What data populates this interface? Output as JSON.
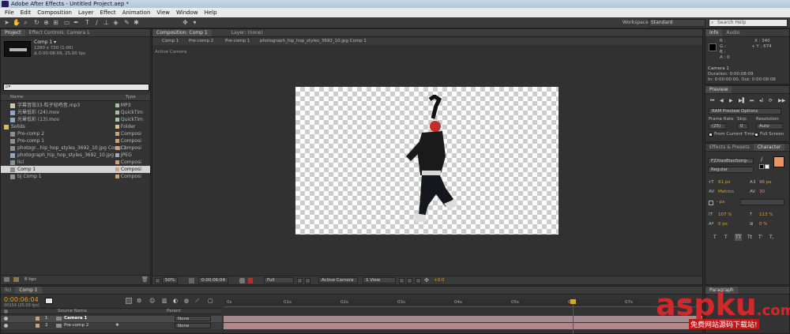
{
  "title": "Adobe After Effects - Untitled Project.aep *",
  "menu": [
    "File",
    "Edit",
    "Composition",
    "Layer",
    "Effect",
    "Animation",
    "View",
    "Window",
    "Help"
  ],
  "workspace": {
    "label": "Workspace:",
    "value": "Standard"
  },
  "search_help": "Search Help",
  "project": {
    "tabs": [
      "Project",
      "Effect Controls: Camera 1"
    ],
    "selected_name": "Comp 1 ▾",
    "info_line1": "1280 x 720 (1.00)",
    "info_line2": "Δ 0:00:08:09, 25.00 fps",
    "search_placeholder": "ρ▾",
    "col_name": "Name",
    "col_type": "Type",
    "items": [
      {
        "name": "字幕音效33-粒子轻鸣音.mp3",
        "type": "MP3",
        "color": "#a5c3a0"
      },
      {
        "name": "光晕低彩 (24).mov",
        "type": "QuickTim",
        "color": "#a5c3a0"
      },
      {
        "name": "光晕低彩 (13).mov",
        "type": "QuickTim",
        "color": "#a5c3a0"
      },
      {
        "name": "Solids",
        "type": "Folder",
        "color": "#d8c48a"
      },
      {
        "name": "Pre-comp 2",
        "type": "Composi",
        "color": "#c9a37a"
      },
      {
        "name": "Pre-comp 1",
        "type": "Composi",
        "color": "#c9a37a"
      },
      {
        "name": "photogr...hip_hop_styles_3692_10.jpg Comp 1",
        "type": "Composi",
        "color": "#c9a37a"
      },
      {
        "name": "photograph_hip_hop_styles_3692_10.jpg",
        "type": "JPEG",
        "color": "#9fa7c9"
      },
      {
        "name": "lici",
        "type": "Composi",
        "color": "#c9a37a"
      },
      {
        "name": "Comp 1",
        "type": "Composi",
        "color": "#c9a37a"
      },
      {
        "name": "bj Comp 1",
        "type": "Composi",
        "color": "#c9a37a"
      }
    ],
    "bpc": "8 bpc"
  },
  "comp": {
    "tabs": [
      "Composition: Comp 1",
      "Layer: (none)"
    ],
    "crumbs": [
      "Comp 1",
      "Pre-comp 2",
      "Pre-comp 1",
      "photograph_hip_hop_styles_3692_10.jpg Comp 1"
    ],
    "active_camera": "Active Camera",
    "zoom": "50%",
    "timecode": "0:00:06:04",
    "resolution": "Full",
    "camera": "Active Camera",
    "views": "1 View",
    "exposure": "+0.0"
  },
  "info": {
    "tabs": [
      "Info",
      "Audio"
    ],
    "r": "R :",
    "g": "G :",
    "b": "B :",
    "a": "A : 0",
    "x": "X : 340",
    "y": "+ Y : 674",
    "cam": "Camera 1",
    "duration": "Duration: 0:00:08:09",
    "inout": "In: 0:00:00:00,  Out: 0:00:08:08"
  },
  "preview": {
    "title": "Preview",
    "ram": "RAM Preview Options",
    "frame_rate_label": "Frame Rate",
    "skip_label": "Skip",
    "res_label": "Resolution",
    "frame_rate": "(25)",
    "skip": "0",
    "res": "Auto",
    "from_current": "From Current Time",
    "full_screen": "Full Screen"
  },
  "character": {
    "tabs": [
      "Effects & Presets",
      "Character"
    ],
    "font": "FZXiaoBiaoSong-...",
    "style": "Regular",
    "size": "61 px",
    "leading": "96 px",
    "kern": "Metrics",
    "tracking": "30",
    "stroke": "- px",
    "stroke_mode": "",
    "vscale": "107 %",
    "hscale": "113 %",
    "baseline": "0 px",
    "tsume": "0 %",
    "fill_color": "#e8956a",
    "styles": [
      "T",
      "T",
      "TT",
      "Tt",
      "T'",
      "T,"
    ]
  },
  "timeline": {
    "tabs": [
      "lici",
      "Comp 1"
    ],
    "timecode": "0:00:06:04",
    "frame": "00154 (25.00 fps)",
    "col_name": "Source Name",
    "col_parent": "Parent",
    "ticks": [
      "0s",
      "01s",
      "02s",
      "03s",
      "04s",
      "05s",
      "06s",
      "07s",
      "08s"
    ],
    "layers": [
      {
        "num": "1",
        "name": "Camera 1",
        "parent": "None"
      },
      {
        "num": "2",
        "name": "Pre-comp 2",
        "parent": "None"
      }
    ],
    "playhead": 0.76
  },
  "paragraph": "Paragraph",
  "watermark": {
    "main": "aspku",
    "tld": ".com",
    "sub": "免费网站源码下载站!"
  }
}
